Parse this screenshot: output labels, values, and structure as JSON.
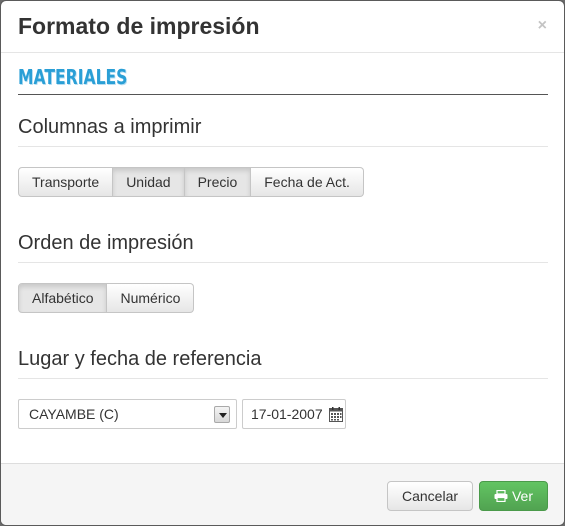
{
  "modal": {
    "title": "Formato de impresión",
    "close_label": "×"
  },
  "section": {
    "brand": "MATERIALES"
  },
  "columns_group": {
    "title": "Columnas a imprimir",
    "buttons": [
      {
        "label": "Transporte",
        "active": false
      },
      {
        "label": "Unidad",
        "active": true
      },
      {
        "label": "Precio",
        "active": true
      },
      {
        "label": "Fecha de Act.",
        "active": false
      }
    ]
  },
  "order_group": {
    "title": "Orden de impresión",
    "buttons": [
      {
        "label": "Alfabético",
        "active": true
      },
      {
        "label": "Numérico",
        "active": false
      }
    ]
  },
  "reference_group": {
    "title": "Lugar y fecha de referencia",
    "place_value": "CAYAMBE (C)",
    "date_value": "17-01-2007"
  },
  "footer": {
    "cancel_label": "Cancelar",
    "view_label": "Ver"
  },
  "colors": {
    "brand": "#2a9fd6",
    "success": "#5bb75b"
  },
  "icons": {
    "close": "close-icon",
    "calendar": "calendar-icon",
    "print": "print-icon",
    "dropdown": "chevron-down-icon"
  }
}
